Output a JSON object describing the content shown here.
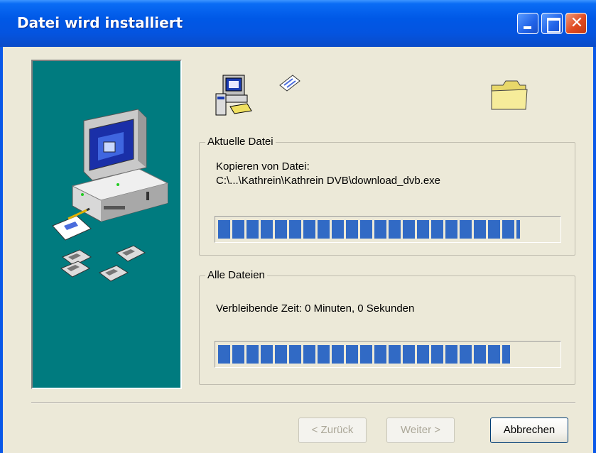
{
  "window": {
    "title": "Datei wird installiert",
    "title_bar_color": "#0058e6",
    "buttons": [
      "minimize-icon",
      "maximize-icon",
      "close-icon"
    ]
  },
  "left_panel": {
    "background": "#007b7f",
    "illustration": "computer-and-disks-icon"
  },
  "icons": {
    "source": "computer-setup-icon",
    "flying": "flying-paper-icon",
    "target": "folder-icon"
  },
  "current_file": {
    "group_label": "Aktuelle Datei",
    "action_text": "Kopieren von Datei:",
    "path": "C:\\...\\Kathrein\\Kathrein DVB\\download_dvb.exe",
    "progress": 0.89
  },
  "all_files": {
    "group_label": "Alle Dateien",
    "remaining_text": "Verbleibende Zeit: 0 Minuten, 0 Sekunden",
    "progress": 0.86
  },
  "buttons": {
    "back_label": "< Zurück",
    "next_label": "Weiter >",
    "cancel_label": "Abbrechen"
  },
  "colors": {
    "progress": "#316ac5",
    "dialog_bg": "#ece9d8"
  }
}
